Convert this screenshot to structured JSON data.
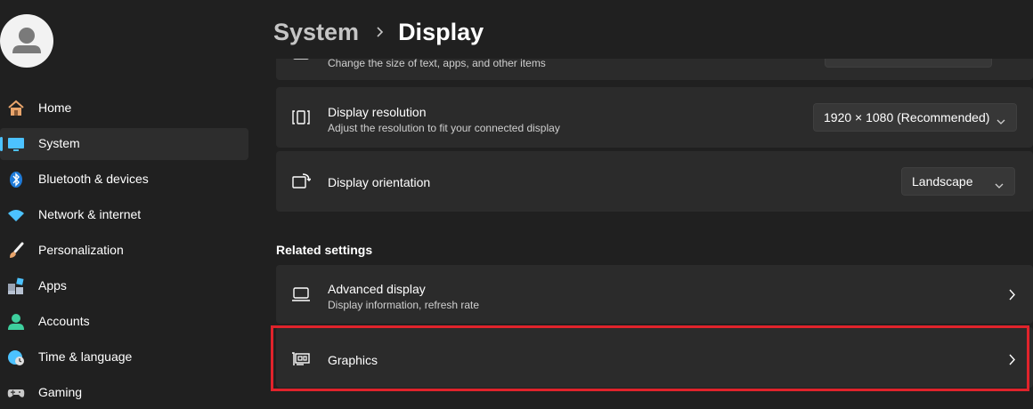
{
  "breadcrumb": {
    "parent": "System",
    "current": "Display"
  },
  "sidebar": {
    "items": [
      {
        "label": "Home",
        "icon": "home-icon",
        "selected": false
      },
      {
        "label": "System",
        "icon": "system-monitor-icon",
        "selected": true
      },
      {
        "label": "Bluetooth & devices",
        "icon": "bluetooth-icon",
        "selected": false
      },
      {
        "label": "Network & internet",
        "icon": "wifi-icon",
        "selected": false
      },
      {
        "label": "Personalization",
        "icon": "paintbrush-icon",
        "selected": false
      },
      {
        "label": "Apps",
        "icon": "apps-icon",
        "selected": false
      },
      {
        "label": "Accounts",
        "icon": "person-icon",
        "selected": false
      },
      {
        "label": "Time & language",
        "icon": "globe-clock-icon",
        "selected": false
      },
      {
        "label": "Gaming",
        "icon": "gamepad-icon",
        "selected": false
      }
    ]
  },
  "scale_card": {
    "subtitle": "Change the size of text, apps, and other items"
  },
  "resolution_card": {
    "title": "Display resolution",
    "subtitle": "Adjust the resolution to fit your connected display",
    "value": "1920 × 1080 (Recommended)"
  },
  "orientation_card": {
    "title": "Display orientation",
    "value": "Landscape"
  },
  "related": {
    "heading": "Related settings",
    "advanced_title": "Advanced display",
    "advanced_subtitle": "Display information, refresh rate",
    "graphics_title": "Graphics"
  },
  "colors": {
    "accent": "#4cc2ff",
    "highlight": "#e0232b",
    "background": "#202020",
    "card": "#2b2b2b"
  }
}
